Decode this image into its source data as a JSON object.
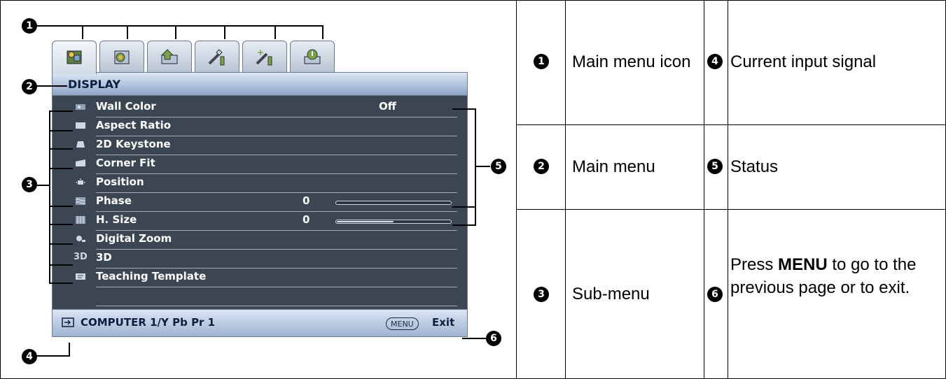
{
  "callouts": [
    "1",
    "2",
    "3",
    "4",
    "5",
    "6"
  ],
  "menu": {
    "header": "DISPLAY",
    "items": [
      {
        "label": "Wall Color",
        "value": "Off",
        "icon": "wall-color-icon"
      },
      {
        "label": "Aspect Ratio",
        "icon": "aspect-ratio-icon"
      },
      {
        "label": "2D Keystone",
        "icon": "keystone-icon"
      },
      {
        "label": "Corner Fit",
        "icon": "corner-fit-icon"
      },
      {
        "label": "Position",
        "icon": "position-icon"
      },
      {
        "label": "Phase",
        "value": "0",
        "slider": 0.0,
        "icon": "phase-icon"
      },
      {
        "label": "H. Size",
        "value": "0",
        "slider": 0.5,
        "icon": "h-size-icon"
      },
      {
        "label": "Digital Zoom",
        "icon": "digital-zoom-icon"
      },
      {
        "label": "3D",
        "icon": "3d-icon"
      },
      {
        "label": "Teaching Template",
        "icon": "teaching-template-icon"
      }
    ],
    "tabs": [
      "display-tab-icon",
      "picture-tab-icon",
      "source-tab-icon",
      "system-basic-tab-icon",
      "system-advanced-tab-icon",
      "information-tab-icon"
    ],
    "footer": {
      "source": "COMPUTER 1/Y Pb Pr 1",
      "menu_key": "MENU",
      "exit": "Exit"
    }
  },
  "legend": {
    "1": "Main menu icon",
    "2": "Main menu",
    "3": "Sub-menu",
    "4": "Current input signal",
    "5": "Status",
    "6_pre": "Press ",
    "6_key": "MENU",
    "6_post": " to go to the previous page or to exit."
  },
  "colors": {
    "menu_body": "#3c4652",
    "header": "#8ea5c6",
    "text_dark": "#0b1f3f"
  }
}
